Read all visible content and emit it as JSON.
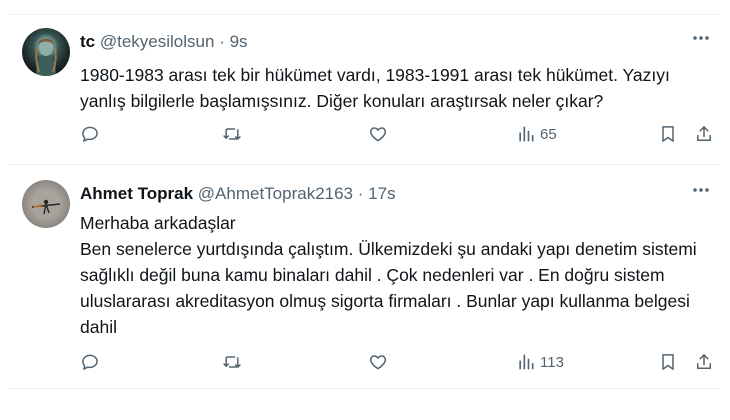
{
  "tweets": [
    {
      "name": "tc",
      "handle": "@tekyesilolsun",
      "dot": "·",
      "time": "9s",
      "text": "1980-1983 arası tek bir hükümet vardı, 1983-1991 arası tek hükümet. Yazıyı yanlış bilgilerle başlamışsınız. Diğer konuları araştırsak neler çıkar?",
      "views": "65"
    },
    {
      "name": "Ahmet Toprak",
      "handle": "@AhmetToprak2163",
      "dot": "·",
      "time": "17s",
      "lines": [
        "Merhaba arkadaşlar",
        "Ben senelerce yurtdışında çalıştım. Ülkemizdeki şu andaki  yapı denetim sistemi sağlıklı değil buna kamu binaları dahil . Çok nedenleri var . En doğru sistem uluslararası akreditasyon olmuş sigorta firmaları . Bunlar yapı kullanma belgesi dahil"
      ],
      "views": "113"
    }
  ],
  "icons": [
    "more-icon",
    "reply-icon",
    "retweet-icon",
    "like-icon",
    "views-icon",
    "bookmark-icon",
    "share-icon"
  ],
  "colors": {
    "text": "#0f1419",
    "secondary": "#536471",
    "separator": "#eff3f4"
  }
}
